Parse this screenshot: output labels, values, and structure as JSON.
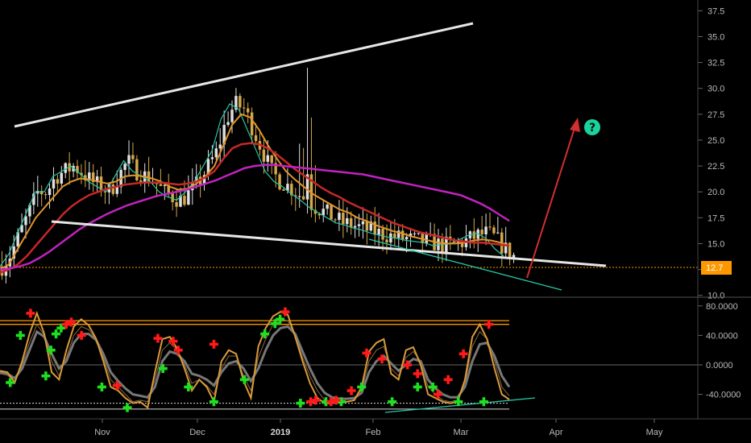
{
  "chart_data": [
    {
      "type": "candlestick",
      "panel": "price",
      "y_axis_ticks": [
        "37.5",
        "35.0",
        "32.5",
        "30.0",
        "27.5",
        "25.0",
        "22.5",
        "20.0",
        "17.5",
        "15.0",
        "12.5",
        "10.0"
      ],
      "ylim": [
        10.0,
        38.5
      ],
      "last_price": {
        "label": "12.7",
        "value": 12.7,
        "color": "#ff9800"
      },
      "x_tick_labels": [
        "Nov",
        "Dec",
        "2019",
        "Feb",
        "Mar",
        "Apr",
        "May"
      ],
      "annotation_icon": "question-circle-icon",
      "colors": {
        "bull": "#e0e0e0",
        "bear": "#d4a74a",
        "ema_fast": "#26c6a6",
        "ema_mid": "#e0952a",
        "ema_slow": "#c62828",
        "ema_long": "#c023c0",
        "trend": "#e6e6e6",
        "support": "#26c6a6",
        "arrow": "#d32f2f",
        "question": "#19d39a"
      },
      "series": [
        {
          "values": [
            12.8,
            14,
            16,
            18,
            20,
            20,
            21.5,
            22,
            22.5,
            21.8,
            21,
            20.5,
            20,
            21.5,
            23,
            22,
            21.5,
            21,
            20,
            19.5,
            19.2,
            20,
            21,
            22.5,
            24,
            27,
            28.5,
            28,
            26,
            24,
            22,
            21,
            20.5,
            19.8,
            19.2,
            18.5,
            18,
            17.5,
            17,
            16.8,
            16.5,
            16.3,
            16,
            15.8,
            15.6,
            15.5,
            15.3,
            15.2,
            15.1,
            14.8,
            14.9,
            15,
            15.4,
            15.8,
            16,
            15.5,
            14.5,
            13.8
          ]
        },
        {
          "values": [
            12.5,
            13,
            14.5,
            16,
            17.5,
            18.5,
            19.5,
            20.5,
            21,
            21.3,
            21.2,
            21,
            20.8,
            21,
            21.5,
            21.6,
            21.5,
            21.3,
            21,
            20.5,
            20.2,
            20.3,
            20.8,
            21.5,
            22.5,
            24.5,
            26.5,
            27.5,
            27.2,
            26,
            24.5,
            23.2,
            22,
            21.2,
            20.5,
            19.8,
            19.3,
            18.8,
            18.3,
            18,
            17.5,
            17.2,
            16.8,
            16.5,
            16.2,
            16,
            15.7,
            15.5,
            15.3,
            15.1,
            15,
            15,
            15.1,
            15.3,
            15.4,
            15.3,
            15.1,
            14.8
          ]
        },
        {
          "values": [
            12.2,
            12.5,
            13,
            13.8,
            14.8,
            15.8,
            16.8,
            17.8,
            18.6,
            19.2,
            19.7,
            20,
            20.3,
            20.5,
            20.7,
            20.8,
            20.9,
            20.9,
            20.9,
            20.8,
            20.7,
            20.8,
            21,
            21.4,
            22,
            23.2,
            24.2,
            24.6,
            24.7,
            24.6,
            24.2,
            23.6,
            22.9,
            22.2,
            21.6,
            21,
            20.4,
            19.9,
            19.5,
            19,
            18.6,
            18.2,
            17.8,
            17.4,
            17,
            16.7,
            16.4,
            16.1,
            15.9,
            15.7,
            15.5,
            15.3,
            15.2,
            15.1,
            15.1,
            15,
            14.9,
            14.8
          ]
        },
        {
          "values": [
            12.5,
            12.6,
            12.8,
            13.1,
            13.6,
            14.2,
            14.9,
            15.6,
            16.3,
            16.9,
            17.4,
            17.9,
            18.3,
            18.7,
            19,
            19.3,
            19.6,
            19.8,
            20,
            20.2,
            20.5,
            20.8,
            21.1,
            21.5,
            21.9,
            22.3,
            22.5,
            22.6,
            22.6,
            22.5,
            22.4,
            22.3,
            22.2,
            22.1,
            22,
            21.9,
            21.8,
            21.7,
            21.5,
            21.3,
            21.1,
            20.9,
            20.7,
            20.5,
            20.3,
            20.1,
            19.9,
            19.7,
            19.3,
            18.9,
            18.4,
            17.8,
            17.2
          ]
        }
      ]
    },
    {
      "type": "line",
      "panel": "oscillator",
      "y_axis_ticks": [
        "80.0000",
        "40.0000",
        "0.0000",
        "-40.0000"
      ],
      "ylim": [
        -70,
        86
      ],
      "reference_levels": [
        60,
        55,
        -52,
        -60
      ],
      "series": [
        {
          "values": [
            -8,
            -10,
            -24,
            5,
            42,
            70,
            42,
            -10,
            -20,
            20,
            52,
            62,
            54,
            36,
            5,
            -30,
            -35,
            -45,
            -52,
            -50,
            -58,
            -10,
            35,
            38,
            22,
            -5,
            -35,
            -20,
            -30,
            -50,
            5,
            20,
            15,
            -22,
            -45,
            25,
            50,
            66,
            72,
            68,
            38,
            5,
            -25,
            -45,
            -52,
            -52,
            -50,
            -50,
            -48,
            -30,
            18,
            30,
            35,
            -12,
            -20,
            20,
            24,
            0,
            -40,
            -45,
            -50,
            -52,
            -50,
            -20,
            38,
            55,
            35,
            -5,
            -40,
            -47
          ]
        },
        {
          "values": [
            -12,
            -14,
            -22,
            0,
            30,
            55,
            40,
            5,
            -15,
            10,
            40,
            52,
            48,
            35,
            10,
            -20,
            -30,
            -40,
            -50,
            -48,
            -50,
            -20,
            20,
            30,
            20,
            0,
            -25,
            -20,
            -28,
            -40,
            -5,
            12,
            12,
            -15,
            -35,
            10,
            35,
            55,
            62,
            60,
            40,
            10,
            -15,
            -35,
            -48,
            -50,
            -50,
            -50,
            -48,
            -35,
            5,
            20,
            25,
            -5,
            -15,
            10,
            18,
            5,
            -30,
            -40,
            -48,
            -50,
            -48,
            -25,
            25,
            45,
            35,
            5,
            -30,
            -42
          ]
        },
        {
          "values": [
            -10,
            -12,
            -18,
            -5,
            20,
            45,
            38,
            15,
            -5,
            5,
            30,
            42,
            42,
            34,
            15,
            -10,
            -22,
            -32,
            -40,
            -42,
            -44,
            -30,
            5,
            18,
            15,
            5,
            -12,
            -15,
            -20,
            -28,
            -10,
            2,
            5,
            -5,
            -22,
            -5,
            20,
            40,
            50,
            52,
            42,
            18,
            -5,
            -25,
            -38,
            -44,
            -46,
            -46,
            -45,
            -38,
            -10,
            5,
            12,
            2,
            -8,
            0,
            8,
            5,
            -20,
            -32,
            -40,
            -44,
            -44,
            -30,
            5,
            28,
            30,
            12,
            -15,
            -30
          ]
        }
      ],
      "buy_markers": [
        [
          2,
          -24
        ],
        [
          4,
          40
        ],
        [
          9,
          -15
        ],
        [
          10,
          20
        ],
        [
          11,
          42
        ],
        [
          12,
          50
        ],
        [
          20,
          -30
        ],
        [
          25,
          -58
        ],
        [
          32,
          -5
        ],
        [
          37,
          -30
        ],
        [
          42,
          -50
        ],
        [
          48,
          -20
        ],
        [
          52,
          42
        ],
        [
          54,
          56
        ],
        [
          55,
          62
        ],
        [
          59,
          -52
        ],
        [
          64,
          -50
        ],
        [
          67,
          -50
        ],
        [
          71,
          -30
        ],
        [
          77,
          -50
        ],
        [
          82,
          -30
        ],
        [
          85,
          -30
        ],
        [
          90,
          -50
        ],
        [
          95,
          -50
        ]
      ],
      "sell_markers": [
        [
          6,
          70
        ],
        [
          13,
          55
        ],
        [
          14,
          58
        ],
        [
          16,
          40
        ],
        [
          23,
          -28
        ],
        [
          31,
          36
        ],
        [
          34,
          32
        ],
        [
          35,
          20
        ],
        [
          42,
          28
        ],
        [
          56,
          72
        ],
        [
          61,
          -50
        ],
        [
          62,
          -48
        ],
        [
          65,
          -50
        ],
        [
          66,
          -48
        ],
        [
          69,
          -35
        ],
        [
          72,
          16
        ],
        [
          75,
          8
        ],
        [
          80,
          0
        ],
        [
          82,
          -12
        ],
        [
          86,
          -40
        ],
        [
          88,
          -20
        ],
        [
          91,
          15
        ],
        [
          96,
          55
        ]
      ]
    }
  ]
}
